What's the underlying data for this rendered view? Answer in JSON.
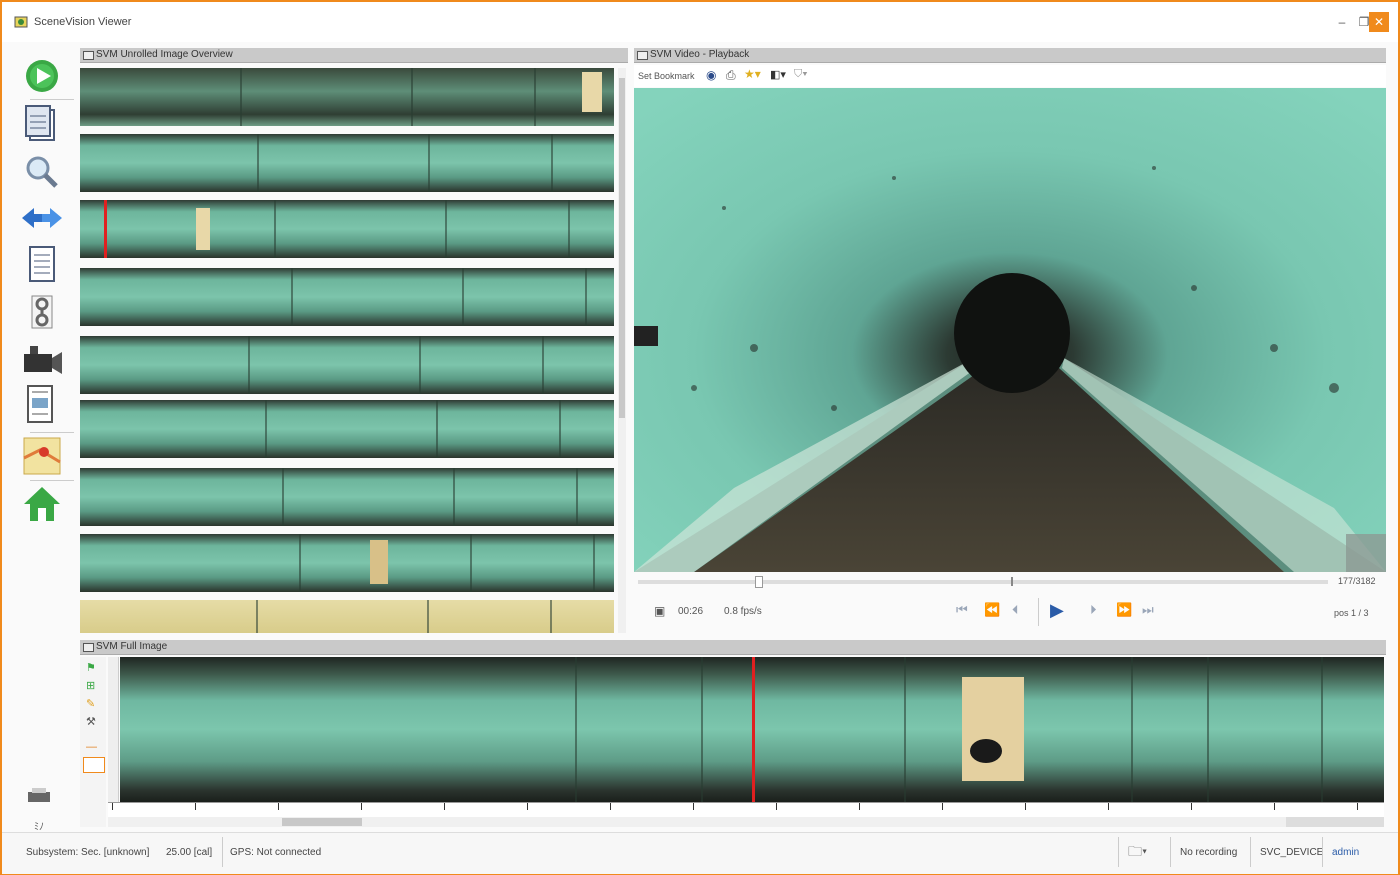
{
  "app": {
    "title": "SceneVision Viewer"
  },
  "panels": {
    "unrolled": {
      "title": "SVM Unrolled Image Overview"
    },
    "video": {
      "title": "SVM Video - Playback"
    },
    "full": {
      "title": "SVM Full Image"
    }
  },
  "video_toolbar": {
    "label": "Set Bookmark"
  },
  "playback": {
    "time": "00:26",
    "speed": "0.8 fps/s",
    "frame_count": "177/3182",
    "position_label": "pos 1 / 3",
    "progress": 0.17,
    "marker2": 0.54
  },
  "full_image": {
    "cursor_fraction": 0.5,
    "scroll_fraction": 0.2
  },
  "sidebar": {
    "items": [
      {
        "name": "play-icon"
      },
      {
        "name": "clipboard-icon"
      },
      {
        "name": "magnifier-icon"
      },
      {
        "name": "arrows-icon"
      },
      {
        "name": "document-icon"
      },
      {
        "name": "tools-icon"
      },
      {
        "name": "camera-icon"
      },
      {
        "name": "report-icon"
      },
      {
        "name": "map-icon"
      },
      {
        "name": "home-icon"
      }
    ],
    "bottom_label": "ﾐﾉ"
  },
  "statusbar": {
    "section": "Subsystem: Sec. [unknown]",
    "value": "25.00 [cal]",
    "connection": "GPS: Not connected",
    "recording": "No recording",
    "device": "SVC_DEVICE",
    "user": "admin"
  },
  "colors": {
    "accent": "#f08a1c",
    "cursor": "#e02020",
    "tunnel": "#6fc0a6"
  }
}
